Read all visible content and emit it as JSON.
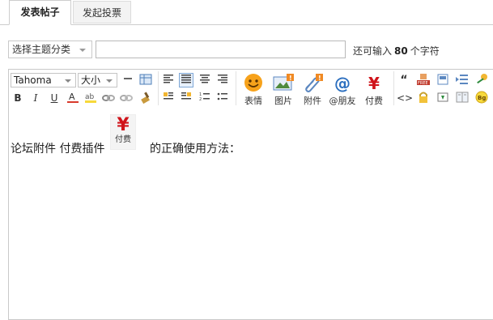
{
  "tabs": {
    "post": "发表帖子",
    "poll": "发起投票"
  },
  "subject": {
    "category": "选择主题分类",
    "remaining_prefix": "还可输入",
    "remaining_count": "80",
    "remaining_suffix": "个字符"
  },
  "toolbar": {
    "font": "Tahoma",
    "size": "大小",
    "emoji": "表情",
    "image": "图片",
    "attach": "附件",
    "at": "@朋友",
    "pay": "付费"
  },
  "content": {
    "text1": "论坛附件  付费插件",
    "inline_pay_label": "付费",
    "text2": "的正确使用方法："
  },
  "colors": {
    "accent": "#7fa7d6",
    "pay_red": "#d0141b"
  }
}
